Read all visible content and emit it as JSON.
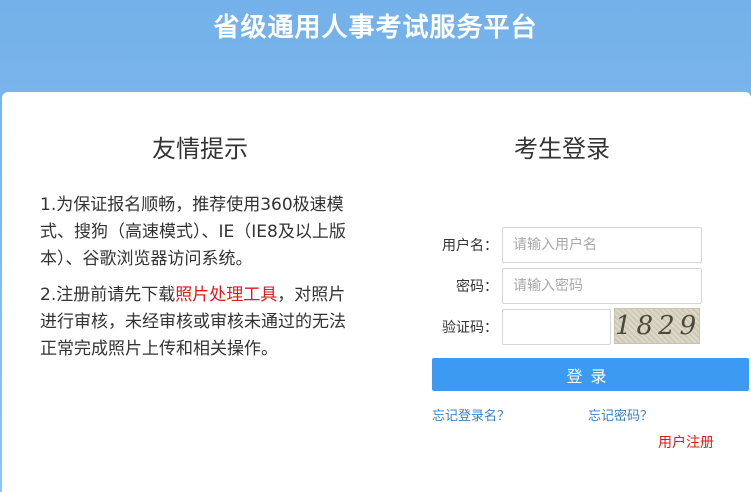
{
  "header": {
    "title": "省级通用人事考试服务平台"
  },
  "tips": {
    "title": "友情提示",
    "item1": "1.为保证报名顺畅，推荐使用360极速模式、搜狗（高速模式）、IE（IE8及以上版本）、谷歌浏览器访问系统。",
    "item2_prefix": "2.注册前请先下载",
    "item2_link": "照片处理工具",
    "item2_suffix": "，对照片进行审核，未经审核或审核未通过的无法正常完成照片上传和相关操作。"
  },
  "login": {
    "title": "考生登录",
    "username_label": "用户名：",
    "username_placeholder": "请输入用户名",
    "password_label": "密码：",
    "password_placeholder": "请输入密码",
    "captcha_label": "验证码：",
    "captcha_text": "1829",
    "submit_label": "登录",
    "forgot_username": "忘记登录名？",
    "forgot_password": "忘记密码？",
    "register": "用户注册"
  },
  "colors": {
    "header_bg": "#74b1ea",
    "button": "#3d9af3",
    "link": "#3d7fc4",
    "accent_red": "#e01a1a"
  }
}
